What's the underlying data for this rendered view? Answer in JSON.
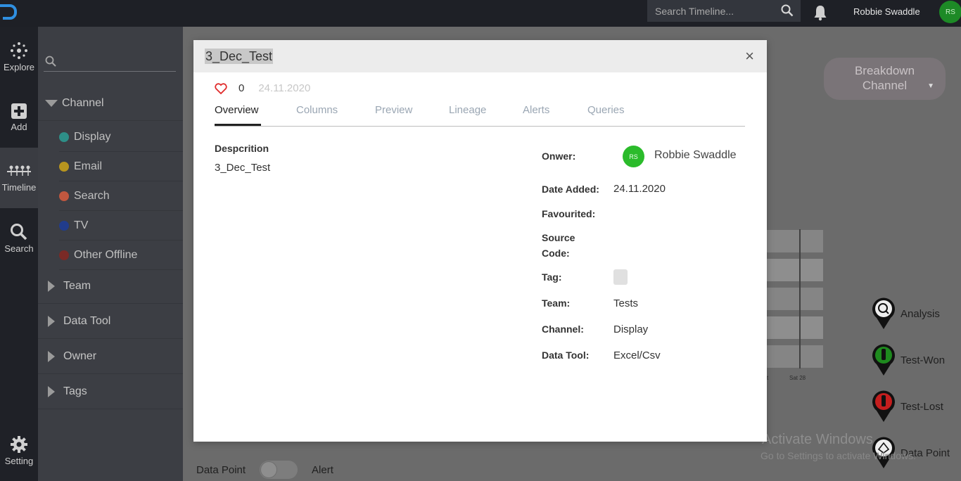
{
  "topbar": {
    "search_placeholder": "Search Timeline...",
    "user_name": "Robbie Swaddle",
    "user_initials": "RS"
  },
  "rail": {
    "items": [
      {
        "label": "Explore",
        "icon": "explore-icon"
      },
      {
        "label": "Add",
        "icon": "add-icon"
      },
      {
        "label": "Timeline",
        "icon": "timeline-icon",
        "active": true
      },
      {
        "label": "Search",
        "icon": "search-icon"
      },
      {
        "label": "Setting",
        "icon": "gear-icon"
      }
    ]
  },
  "filters": {
    "channel_label": "Channel",
    "channels": [
      {
        "label": "Display",
        "color": "#2e8f88"
      },
      {
        "label": "Email",
        "color": "#b8951f"
      },
      {
        "label": "Search",
        "color": "#c0573f"
      },
      {
        "label": "TV",
        "color": "#213c8c"
      },
      {
        "label": "Other Offline",
        "color": "#7a2a26"
      }
    ],
    "groups": [
      "Team",
      "Data Tool",
      "Owner",
      "Tags"
    ]
  },
  "background": {
    "breakdown_label_1": "Breakdown",
    "breakdown_label_2": "Channel",
    "axis_tick_1": "t",
    "axis_tick_2": "Sat 28",
    "legend": [
      "Analysis",
      "Test-Won",
      "Test-Lost",
      "Data Point"
    ],
    "legend_colors": [
      "#6c6c6c",
      "#1e8a1e",
      "#c41e1e",
      "#6c6c6c"
    ],
    "watermark_title": "Activate Windows",
    "watermark_sub": "Go to Settings to activate Windows.",
    "data_point_label": "Data Point",
    "alert_label": "Alert"
  },
  "modal": {
    "title": "3_Dec_Test",
    "close_symbol": "×",
    "like_count": "0",
    "date": "24.11.2020",
    "tabs": [
      "Overview",
      "Columns",
      "Preview",
      "Lineage",
      "Alerts",
      "Queries"
    ],
    "active_tab": "Overview",
    "description_label": "Despcrition",
    "description_value": "3_Dec_Test",
    "owner_label": "Onwer:",
    "owner_initials": "RS",
    "owner_name": "Robbie Swaddle",
    "date_added_label": "Date Added:",
    "date_added_value": "24.11.2020",
    "favourited_label": "Favourited:",
    "source_code_label_1": "Source",
    "source_code_label_2": "Code:",
    "tag_label": "Tag:",
    "team_label": "Team:",
    "team_value": "Tests",
    "channel_label": "Channel:",
    "channel_value": "Display",
    "data_tool_label": "Data Tool:",
    "data_tool_value": "Excel/Csv"
  }
}
